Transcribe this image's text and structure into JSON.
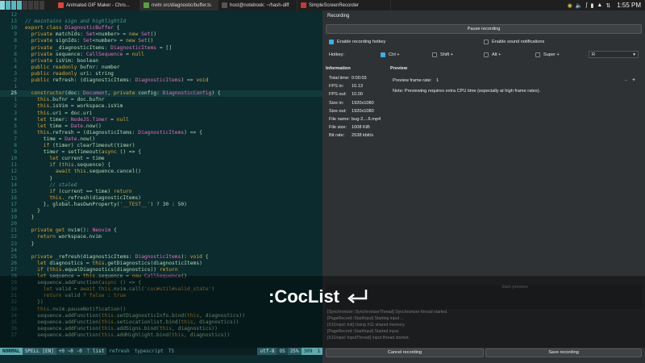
{
  "workspaces": [
    "1",
    "2",
    "3",
    "4",
    "5",
    "6",
    "7",
    "8"
  ],
  "taskbar": {
    "tasks": [
      {
        "label": "Animated GIF Maker - Chro...",
        "color": "#d9473a"
      },
      {
        "label": "nvim src/diagnostic/buffer.ts",
        "color": "#57a143"
      },
      {
        "label": "host@notebook: ~/hash-diff",
        "color": "#555555"
      },
      {
        "label": "SimpleScreenRecorder",
        "color": "#c33a3a"
      }
    ],
    "clock": "1:55 PM"
  },
  "editor": {
    "lines": [
      {
        "n": "12",
        "t": ""
      },
      {
        "n": "13",
        "t": "// maintains sign and highlightId"
      },
      {
        "n": "10",
        "t": "export class DiagnosticBuffer {"
      },
      {
        "n": "9",
        "t": "  private matchIds: Set<number> = new Set()"
      },
      {
        "n": "8",
        "t": "  private signIds: Set<number> = new Set()"
      },
      {
        "n": "7",
        "t": "  private _diagnosticItems: DiagnosticItems = []"
      },
      {
        "n": "6",
        "t": "  private sequence: CallSequence = null"
      },
      {
        "n": "5",
        "t": "  private isVim: boolean"
      },
      {
        "n": "4",
        "t": "  public readonly bufnr: number"
      },
      {
        "n": "3",
        "t": "  public readonly uri: string"
      },
      {
        "n": "2",
        "t": "  public refresh: (diagnosticItems: DiagnosticItems) => void"
      },
      {
        "n": "1",
        "t": ""
      },
      {
        "n": "25",
        "t": "  constructor(doc: Document, private config: DiagnosticConfig) {"
      },
      {
        "n": "1",
        "t": "    this.bufnr = doc.bufnr"
      },
      {
        "n": "2",
        "t": "    this.isVim = workspace.isVim"
      },
      {
        "n": "3",
        "t": "    this.uri = doc.uri"
      },
      {
        "n": "4",
        "t": "    let timer: NodeJS.Timer = null"
      },
      {
        "n": "5",
        "t": "    let time = Date.now()"
      },
      {
        "n": "6",
        "t": "    this.refresh = (diagnosticItems: DiagnosticItems) => {"
      },
      {
        "n": "7",
        "t": "      time = Date.now()"
      },
      {
        "n": "8",
        "t": "      if (timer) clearTimeout(timer)"
      },
      {
        "n": "9",
        "t": "      timer = setTimeout(async () => {"
      },
      {
        "n": "10",
        "t": "        let current = time"
      },
      {
        "n": "11",
        "t": "        if (this.sequence) {"
      },
      {
        "n": "12",
        "t": "          await this.sequence.cancel()"
      },
      {
        "n": "13",
        "t": "        }"
      },
      {
        "n": "14",
        "t": "        // staled"
      },
      {
        "n": "15",
        "t": "        if (current == time) return"
      },
      {
        "n": "16",
        "t": "        this._refresh(diagnosticItems)"
      },
      {
        "n": "17",
        "t": "      }, global.hasOwnProperty('__TEST__') ? 30 : 50)"
      },
      {
        "n": "18",
        "t": "    }"
      },
      {
        "n": "19",
        "t": "  }"
      },
      {
        "n": "20",
        "t": ""
      },
      {
        "n": "21",
        "t": "  private get nvim(): Neovim {"
      },
      {
        "n": "22",
        "t": "    return workspace.nvim"
      },
      {
        "n": "23",
        "t": "  }"
      },
      {
        "n": "24",
        "t": ""
      },
      {
        "n": "25",
        "t": "  private _refresh(diagnosticItems: DiagnosticItems): void {"
      },
      {
        "n": "26",
        "t": "    let diagnostics = this.getDiagnostics(diagnosticItems)"
      },
      {
        "n": "27",
        "t": "    if (this.equalDiagnostics(diagnostics)) return"
      },
      {
        "n": "28",
        "t": "    let sequence = this.sequence = new CallSequence()"
      },
      {
        "n": "29",
        "t": "    sequence.addFunction(async () => {"
      },
      {
        "n": "30",
        "t": "      let valid = await this.nvim.call('coc#util#valid_state')"
      },
      {
        "n": "31",
        "t": "      return valid ? false : true"
      },
      {
        "n": "32",
        "t": "    })"
      },
      {
        "n": "33",
        "t": "    this.nvim.pauseNotification()"
      },
      {
        "n": "34",
        "t": "    sequence.addFunction(this.setDiagnosticInfo.bind(this, diagnostics))"
      },
      {
        "n": "35",
        "t": "    sequence.addFunction(this.setLocationlist.bind(this, diagnostics))"
      },
      {
        "n": "36",
        "t": "    sequence.addFunction(this.addSigns.bind(this, diagnostics))"
      },
      {
        "n": "37",
        "t": "    sequence.addFunction(this.addHighlight.bind(this, diagnostics))"
      }
    ],
    "current_line_index": 12,
    "colors": {
      "keyword": "#d6a53a",
      "type": "#e36fbf",
      "comment": "#4f9a9a",
      "string": "#c9a04a",
      "plain": "#b5d9b5"
    }
  },
  "statusline": {
    "mode": "NORMAL",
    "spell": "SPELL [EN]",
    "git": "+0 ~0 -0",
    "branch": "list",
    "file": "refresh",
    "filetype": "typescript",
    "ts": "TS",
    "encoding": "utf-8",
    "os": "OS",
    "percent": "25%",
    "position": "309",
    "col": "1"
  },
  "overlay": {
    "keystroke": ":CocList"
  },
  "recorder": {
    "section_title": "Recording",
    "pause_button": "Pause recording",
    "hotkey_enable": "Enable recording hotkey",
    "hotkey_enable_checked": true,
    "sound_enable": "Enable sound notifications",
    "sound_enable_checked": false,
    "hotkey_label": "Hotkey:",
    "modifiers": [
      {
        "label": "Ctrl +",
        "checked": true
      },
      {
        "label": "Shift +",
        "checked": false
      },
      {
        "label": "Alt +",
        "checked": false
      },
      {
        "label": "Super +",
        "checked": false
      }
    ],
    "hotkey_key": "R",
    "info_title": "Information",
    "info": [
      {
        "k": "Total time:",
        "v": "0:00:03"
      },
      {
        "k": "FPS in:",
        "v": "10.13"
      },
      {
        "k": "FPS out:",
        "v": "10.00"
      },
      {
        "k": "Size in:",
        "v": "1920x1080"
      },
      {
        "k": "Size out:",
        "v": "1920x1080"
      },
      {
        "k": "File name:",
        "v": "bug-2....6.mp4"
      },
      {
        "k": "File size:",
        "v": "1008 KiB"
      },
      {
        "k": "Bit rate:",
        "v": "2538 kbit/s"
      }
    ],
    "preview_title": "Preview",
    "preview_rate_label": "Preview frame rate:",
    "preview_rate_value": "1",
    "preview_note": "Note: Previewing requires extra CPU time (especially at high frame rates).",
    "start_preview": "Start preview",
    "log": [
      "[Synchronizer::SynchronizerThread] Synchronizer thread started.",
      "[PageRecord::StartInput] Starting input ...",
      "[X11Input::Init] Using X11 shared memory.",
      "[PageRecord::StartInput] Started input.",
      "[X11Input::InputThread] Input thread started."
    ],
    "cancel_button": "Cancel recording",
    "save_button": "Save recording"
  }
}
